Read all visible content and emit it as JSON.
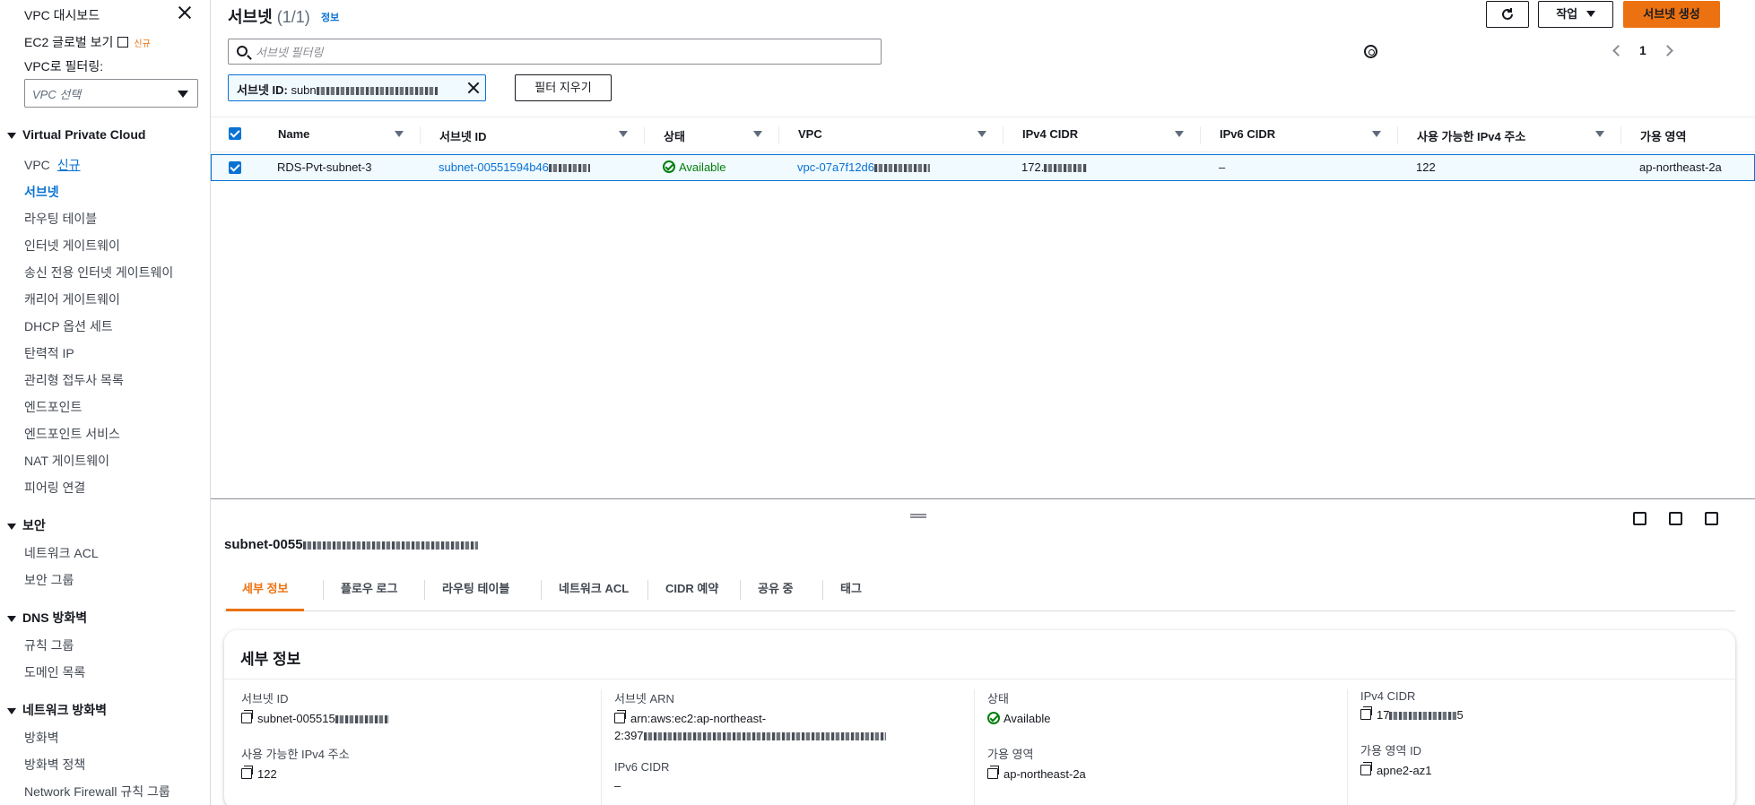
{
  "sidebar": {
    "dashboard": "VPC 대시보드",
    "global_view": "EC2 글로벌 보기",
    "global_view_badge": "신규",
    "filter_label": "VPC로 필터링:",
    "filter_select": "VPC 선택",
    "section_vpc": "Virtual Private Cloud",
    "vpc_items": [
      "VPC",
      "서브넷",
      "라우팅 테이블",
      "인터넷 게이트웨이",
      "송신 전용 인터넷 게이트웨이",
      "캐리어 게이트웨이",
      "DHCP 옵션 세트",
      "탄력적 IP",
      "관리형 접두사 목록",
      "엔드포인트",
      "엔드포인트 서비스",
      "NAT 게이트웨이",
      "피어링 연결"
    ],
    "vpc_new": "신규",
    "section_security": "보안",
    "security_items": [
      "네트워크 ACL",
      "보안 그룹"
    ],
    "section_dns": "DNS 방화벽",
    "dns_items": [
      "규칙 그룹",
      "도메인 목록"
    ],
    "section_nfw": "네트워크 방화벽",
    "nfw_items": [
      "방화벽",
      "방화벽 정책",
      "Network Firewall 규칙 그룹"
    ]
  },
  "header": {
    "title": "서브넷",
    "count": "(1/1)",
    "info": "정보",
    "actions_label": "작업",
    "create_label": "서브넷 생성",
    "search_placeholder": "서브넷 필터링",
    "token_key": "서브넷 ID:",
    "token_value": "subn",
    "clear_filters": "필터 지우기",
    "page": "1"
  },
  "table": {
    "columns": [
      "Name",
      "서브넷 ID",
      "상태",
      "VPC",
      "IPv4 CIDR",
      "IPv6 CIDR",
      "사용 가능한 IPv4 주소",
      "가용 영역"
    ],
    "row": {
      "name": "RDS-Pvt-subnet-3",
      "subnet_id": "subnet-00551594b46",
      "state": "Available",
      "vpc": "vpc-07a7f12d6",
      "ipv4": "172.",
      "ipv6": "–",
      "available_ips": "122",
      "az": "ap-northeast-2a"
    }
  },
  "details": {
    "title": "subnet-0055",
    "tabs": [
      "세부 정보",
      "플로우 로그",
      "라우팅 테이블",
      "네트워크 ACL",
      "CIDR 예약",
      "공유 중",
      "태그"
    ],
    "card_title": "세부 정보",
    "subnet_id_label": "서브넷 ID",
    "subnet_id_value": "subnet-005515",
    "available_label": "사용 가능한 IPv4 주소",
    "available_value": "122",
    "arn_label": "서브넷 ARN",
    "arn_value_1": "arn:aws:ec2:ap-northeast-",
    "arn_value_2": "2:397",
    "ipv6_label": "IPv6 CIDR",
    "ipv6_value": "–",
    "state_label": "상태",
    "state_value": "Available",
    "az_label": "가용 영역",
    "az_value": "ap-northeast-2a",
    "ipv4_label": "IPv4 CIDR",
    "ipv4_value_pre": "17",
    "ipv4_value_post": "5",
    "az_id_label": "가용 영역 ID",
    "az_id_value": "apne2-az1"
  },
  "colors": {
    "accent": "#ec7211",
    "link": "#0972d3",
    "success": "#037f0c"
  }
}
